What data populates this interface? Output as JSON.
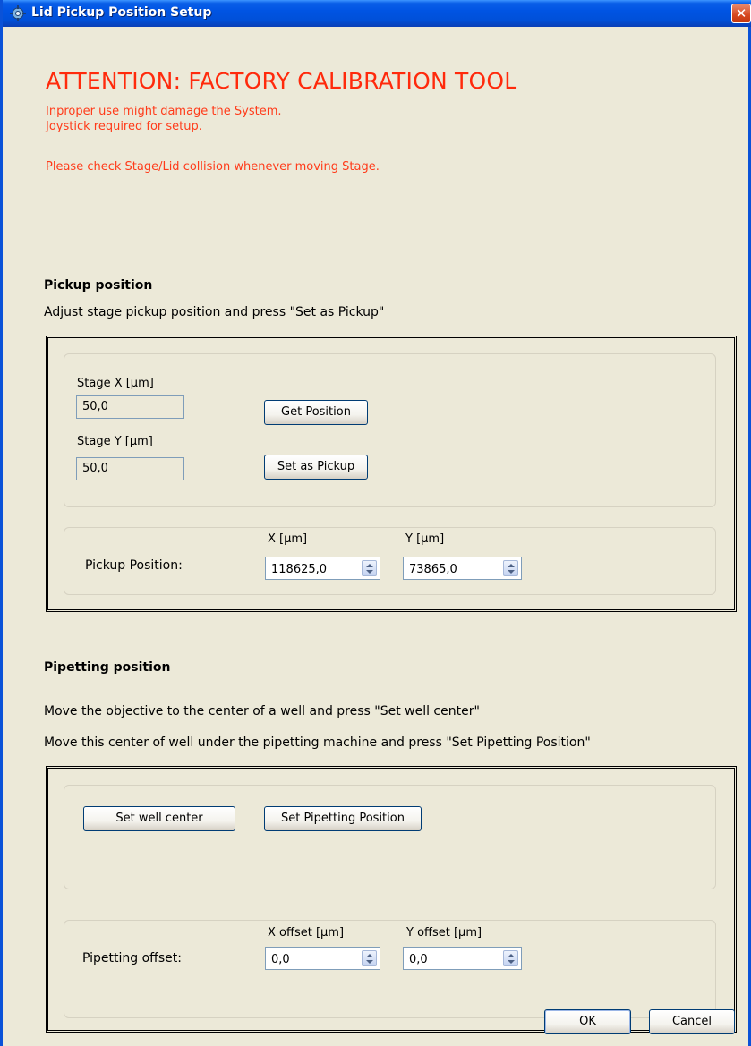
{
  "window": {
    "title": "Lid Pickup Position Setup",
    "close_glyph": "✕",
    "icon": "app-gear-icon",
    "accent": "#0054e3"
  },
  "attention": {
    "title": "ATTENTION: FACTORY CALIBRATION TOOL",
    "line1": "Inproper use might damage the System.",
    "line2": "Joystick required for setup.",
    "line3": "Please check Stage/Lid collision whenever moving Stage.",
    "color": "#ff2a0c"
  },
  "pickup": {
    "title": "Pickup position",
    "description": "Adjust stage pickup position and press \"Set as Pickup\"",
    "stage_x_label": "Stage X [µm]",
    "stage_x_value": "50,0",
    "stage_y_label": "Stage Y [µm]",
    "stage_y_value": "50,0",
    "get_position_label": "Get Position",
    "set_as_pickup_label": "Set as Pickup",
    "position_label": "Pickup Position:",
    "x_label": "X [µm]",
    "x_value": "118625,0",
    "y_label": "Y [µm]",
    "y_value": "73865,0"
  },
  "pipetting": {
    "title": "Pipetting position",
    "description1": "Move the objective to the center of a well and press \"Set well center\"",
    "description2": "Move this center of well under the pipetting machine and press \"Set Pipetting Position\"",
    "set_well_center_label": "Set well center",
    "set_pipetting_position_label": "Set Pipetting Position",
    "offset_label": "Pipetting offset:",
    "x_offset_label": "X offset [µm]",
    "x_offset_value": "0,0",
    "y_offset_label": "Y offset [µm]",
    "y_offset_value": "0,0"
  },
  "footer": {
    "ok_label": "OK",
    "cancel_label": "Cancel"
  }
}
